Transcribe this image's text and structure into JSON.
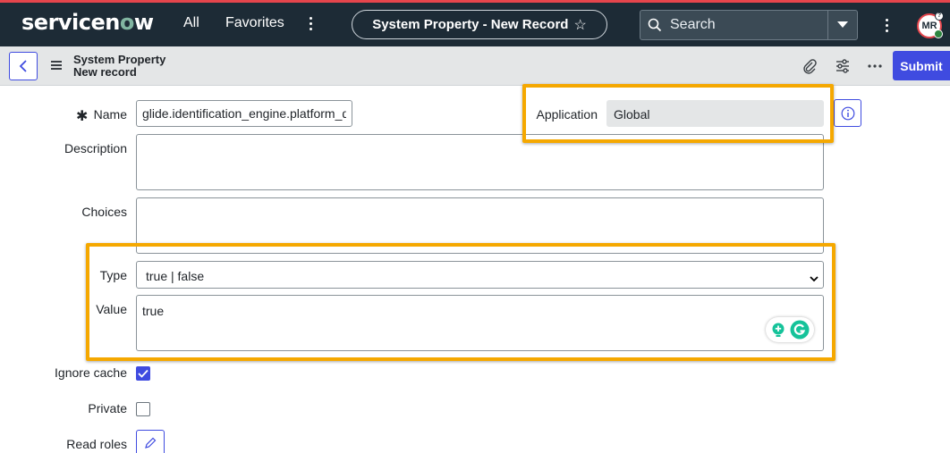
{
  "nav": {
    "logo": "servicenow",
    "all_label": "All",
    "favorites_label": "Favorites",
    "record_title": "System Property - New Record",
    "search_placeholder": "Search",
    "avatar_initials": "MR",
    "avatar_badge": "?"
  },
  "record_header": {
    "line1": "System Property",
    "line2": "New record",
    "submit_label": "Submit"
  },
  "form": {
    "name": {
      "label": "Name",
      "value": "glide.identification_engine.platform_de"
    },
    "application": {
      "label": "Application",
      "value": "Global"
    },
    "description": {
      "label": "Description",
      "value": ""
    },
    "choices": {
      "label": "Choices",
      "value": ""
    },
    "type": {
      "label": "Type",
      "value": "true | false"
    },
    "value": {
      "label": "Value",
      "value": "true"
    },
    "ignore_cache": {
      "label": "Ignore cache",
      "checked": true
    },
    "private": {
      "label": "Private",
      "checked": false
    },
    "read_roles": {
      "label": "Read roles"
    }
  },
  "colors": {
    "nav_bg": "#1d2b36",
    "accent": "#3f4be0",
    "highlight": "#f5a800",
    "brand_red": "#e5454c"
  },
  "icons": {
    "search": "search-icon",
    "star": "star-icon",
    "attachment": "paperclip-icon",
    "settings": "sliders-icon",
    "info": "info-icon",
    "edit": "pencil-icon"
  }
}
